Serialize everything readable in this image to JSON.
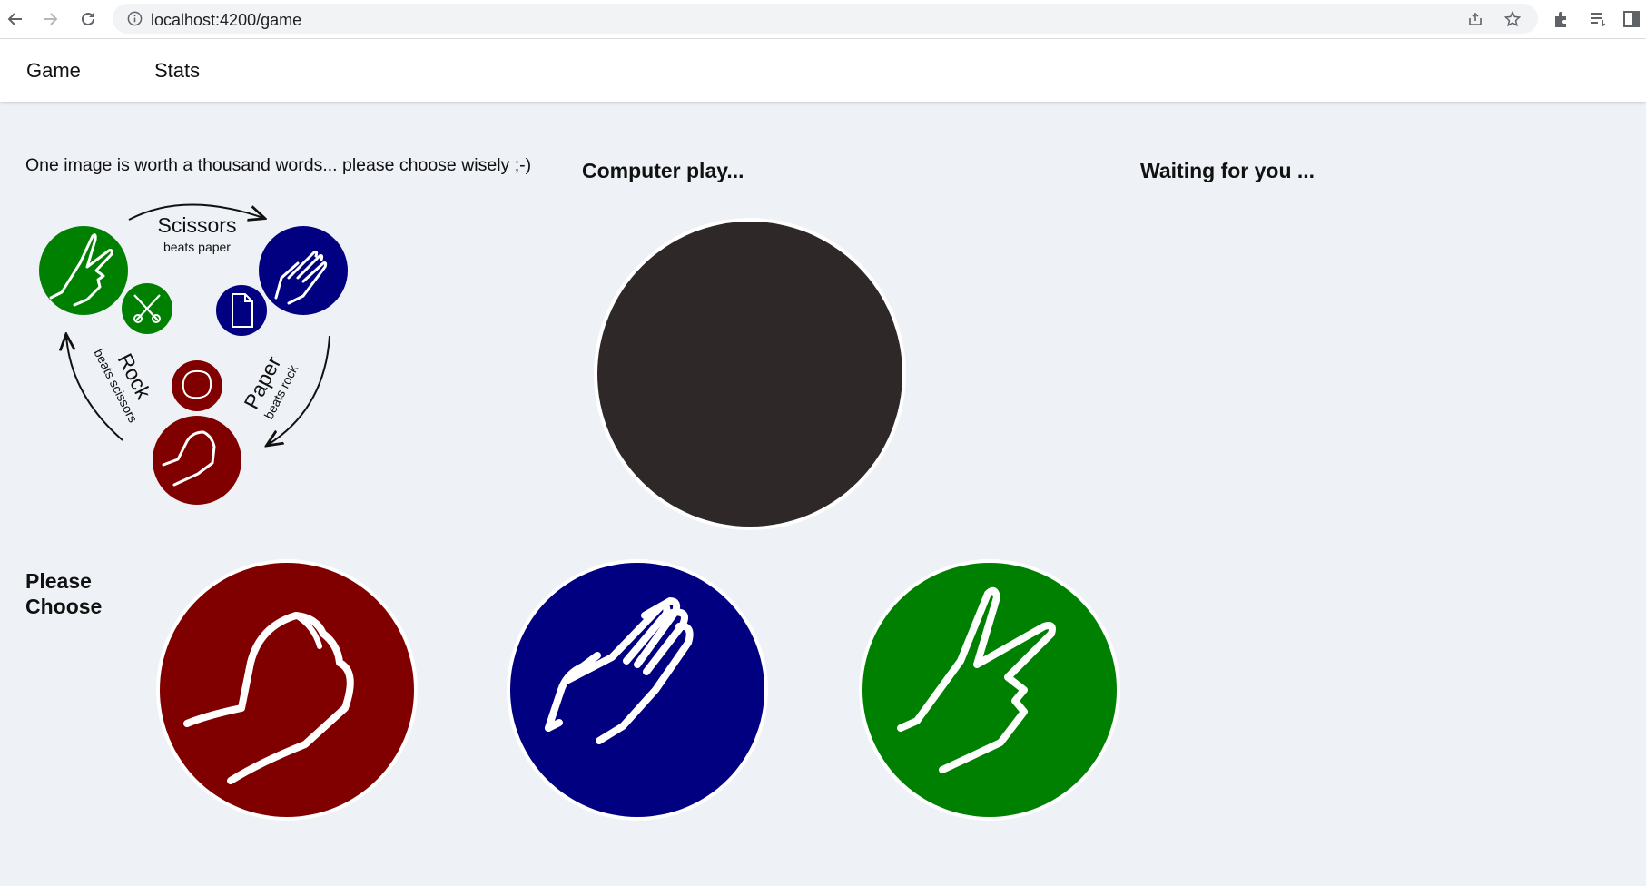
{
  "browser": {
    "url": "localhost:4200/game"
  },
  "nav": {
    "tabs": [
      {
        "label": "Game"
      },
      {
        "label": "Stats"
      }
    ]
  },
  "intro": "One image is worth a thousand words... please choose wisely ;-)",
  "computer": {
    "heading": "Computer play..."
  },
  "status": {
    "heading": "Waiting for you ..."
  },
  "choose": {
    "heading": "Please Choose",
    "options": [
      {
        "name": "rock",
        "color": "#800000"
      },
      {
        "name": "paper",
        "color": "#000080"
      },
      {
        "name": "scissors",
        "color": "#008000"
      }
    ]
  },
  "rules": {
    "scissors": {
      "title": "Scissors",
      "beats": "beats paper"
    },
    "paper": {
      "title": "Paper",
      "beats": "beats rock"
    },
    "rock": {
      "title": "Rock",
      "beats": "beats scissors"
    }
  },
  "colors": {
    "rock": "#800000",
    "paper": "#000080",
    "scissors": "#008000",
    "computer_disc": "#2e2828",
    "background": "#eef1f6"
  }
}
